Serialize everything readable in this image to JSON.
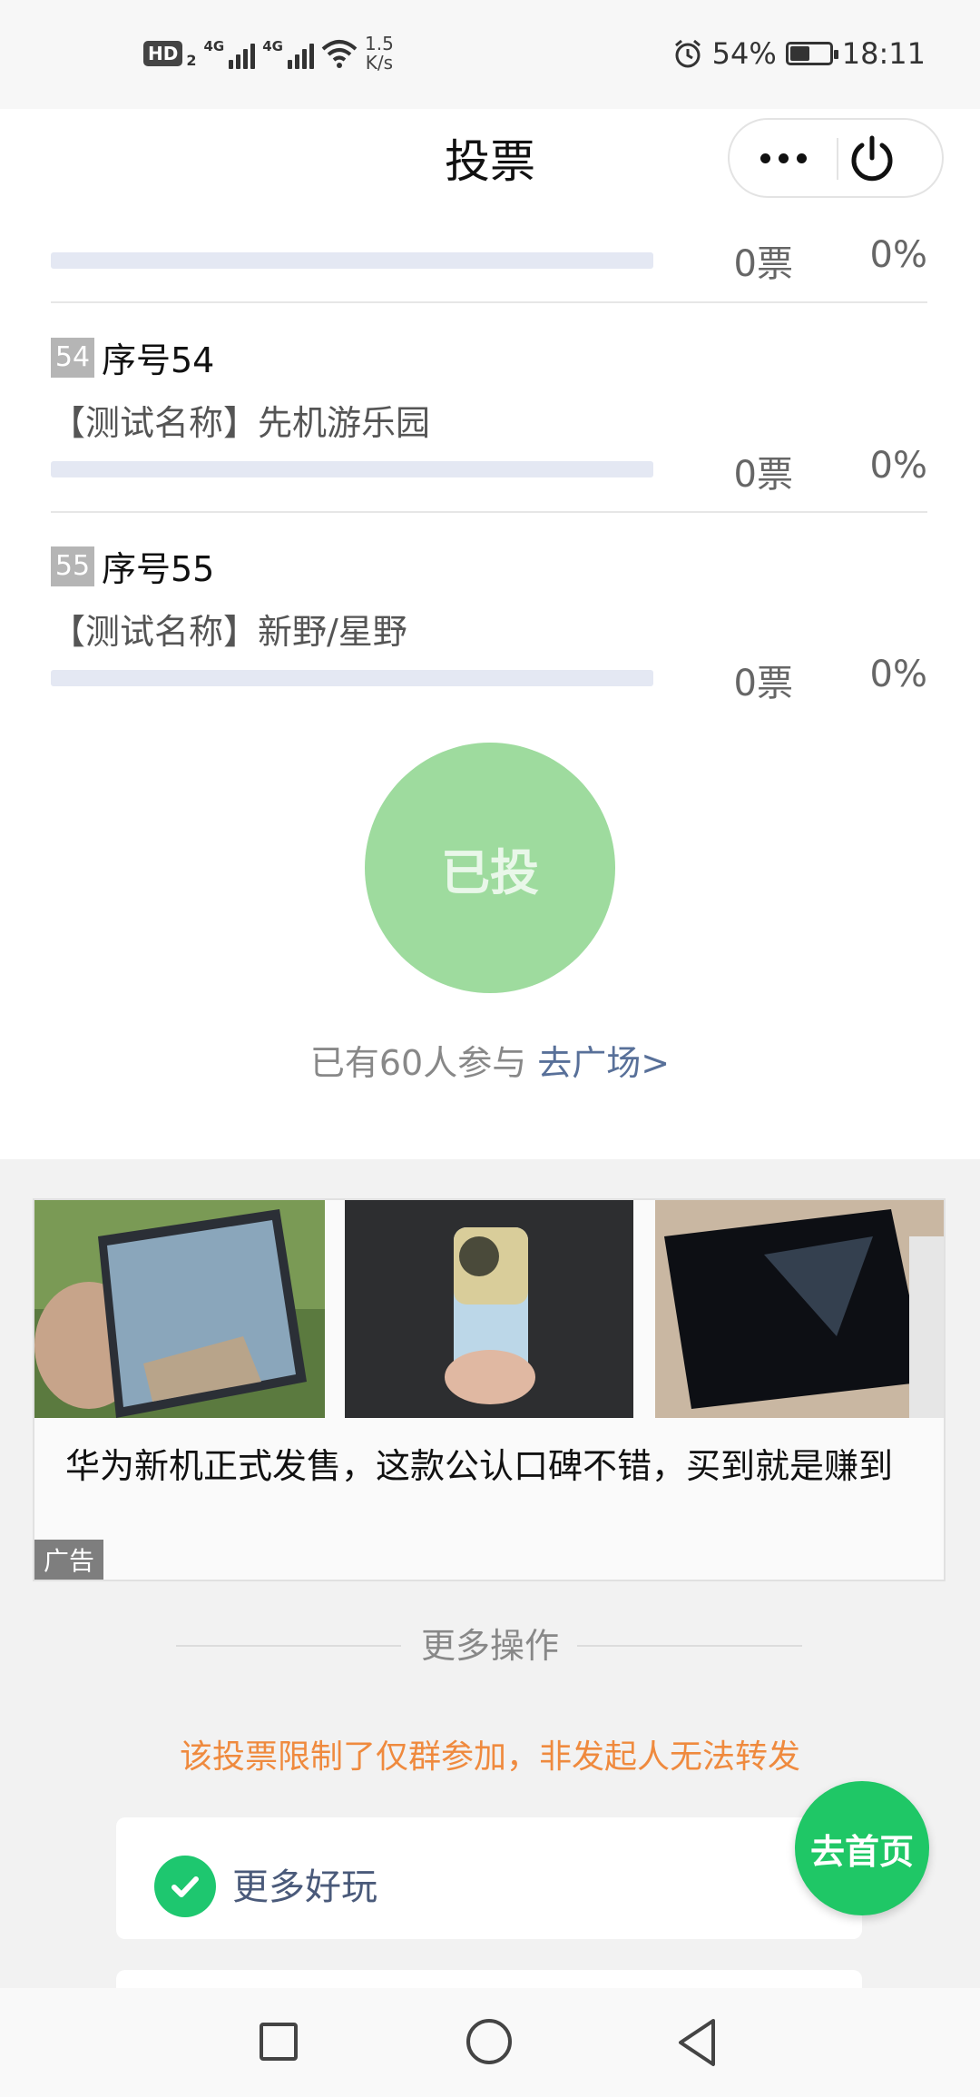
{
  "status_bar": {
    "hd": "HD",
    "hd_sub": "2",
    "network1": "4G",
    "network2": "4G",
    "speed_value": "1.5",
    "speed_unit": "K/s",
    "battery_percent": "54%",
    "battery_level": 0.54,
    "time": "18:11"
  },
  "nav": {
    "title": "投票"
  },
  "items": [
    {
      "badge": "54",
      "title": "序号54",
      "name": "【测试名称】先机游乐园",
      "votes": "0票",
      "percent": "0%",
      "fill": 0
    },
    {
      "badge": "55",
      "title": "序号55",
      "name": "【测试名称】新野/星野",
      "votes": "0票",
      "percent": "0%",
      "fill": 0
    }
  ],
  "partial_item": {
    "votes": "0票",
    "percent": "0%"
  },
  "vote_button": "已投",
  "participants": {
    "text": "已有60人参与 ",
    "link": "去广场>"
  },
  "ad": {
    "tag": "广告",
    "text": "华为新机正式发售，这款公认口碑不错，买到就是赚到"
  },
  "more_ops": {
    "title": "更多操作",
    "restriction": "该投票限制了仅群参加，非发起人无法转发",
    "more_fun": "更多好玩"
  },
  "home_button": "去首页",
  "colors": {
    "vote_button": "#9edb9e",
    "link": "#587099",
    "warning": "#ef8a3e",
    "fab": "#1fc766",
    "bar_track": "#e4e8f3"
  }
}
